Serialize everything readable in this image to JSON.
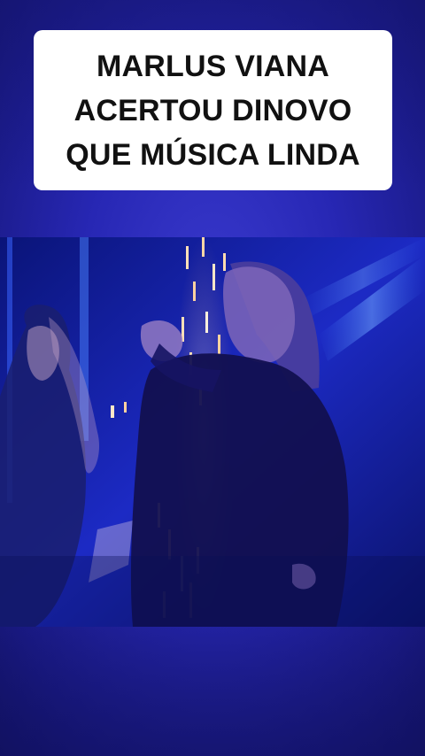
{
  "caption": {
    "lines": [
      "MARLUS VIANA",
      "ACERTOU DINOVO",
      "QUE MÚSICA LINDA"
    ]
  },
  "video": {
    "subject": "concert-performance-still"
  },
  "colors": {
    "background": "#2727b4",
    "caption_box": "#ffffff",
    "caption_text": "#111111",
    "stage_light": "#ffd2a0"
  }
}
